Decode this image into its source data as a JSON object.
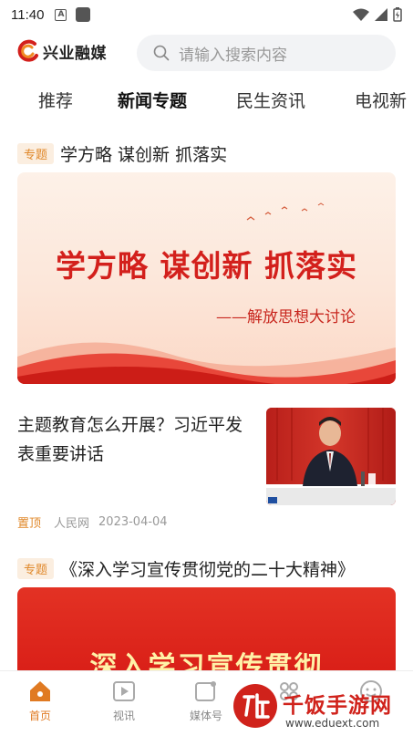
{
  "status_bar": {
    "time": "11:40",
    "a_glyph": "A"
  },
  "header": {
    "logo_text": "兴业融媒",
    "search_placeholder": "请输入搜索内容"
  },
  "tabs": [
    "推荐",
    "新闻专题",
    "民生资讯",
    "电视新"
  ],
  "active_tab": "新闻专题",
  "feed": {
    "topic1": {
      "badge": "专题",
      "title": "学方略 谋创新 抓落实",
      "banner_title": "学方略  谋创新  抓落实",
      "banner_subtitle": "——解放思想大讨论"
    },
    "news": {
      "title": "主题教育怎么开展？习近平发表重要讲话",
      "pin": "置顶",
      "source": "人民网",
      "date": "2023-04-04"
    },
    "topic2": {
      "badge": "专题",
      "title": "《深入学习宣传贯彻党的二十大精神》",
      "banner_title": "深入学习宣传贯彻"
    }
  },
  "bottom_nav": [
    {
      "label": "首页",
      "icon": "home-icon",
      "active": true
    },
    {
      "label": "视讯",
      "icon": "video-icon",
      "active": false
    },
    {
      "label": "媒体号",
      "icon": "media-icon",
      "active": false
    },
    {
      "label": "",
      "icon": "service-icon",
      "active": false
    },
    {
      "label": "",
      "icon": "profile-icon",
      "active": false
    }
  ],
  "watermark": {
    "text": "千饭手游网",
    "url": "www.eduext.com"
  },
  "colors": {
    "accent": "#e07a22",
    "badge_bg": "#fbeee0",
    "red": "#d3201c"
  }
}
